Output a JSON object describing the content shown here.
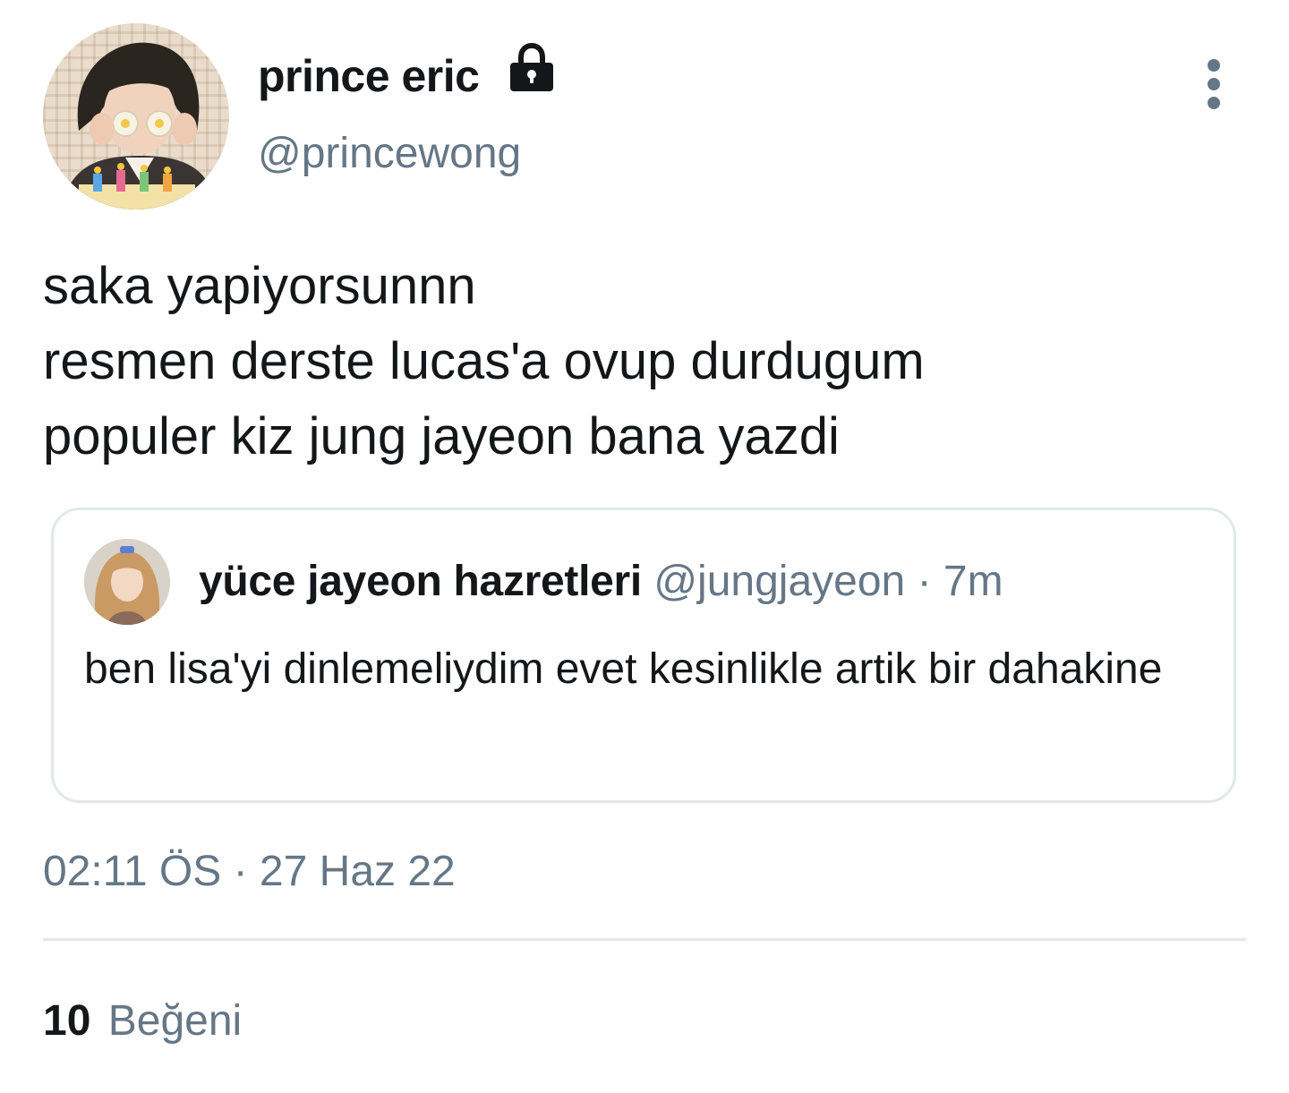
{
  "author": {
    "display_name": "prince eric",
    "handle": "@princewong",
    "protected": true,
    "lock_icon": "lock-icon",
    "avatar_icon": "user-avatar"
  },
  "tweet": {
    "lines": [
      "saka yapiyorsunnn",
      "resmen derste lucas'a ovup durdugum",
      "populer kiz jung jayeon bana yazdi"
    ]
  },
  "quoted_tweet": {
    "display_name": "yüce jayeon hazretleri",
    "handle": "@jungjayeon",
    "separator": "·",
    "time": "7m",
    "text": "ben lisa'yi dinlemeliydim evet kesinlikle artik bir dahakine"
  },
  "timestamp": {
    "time": "02:11 ÖS",
    "separator": "·",
    "date": "27 Haz 22"
  },
  "stats": {
    "likes_count": "10",
    "likes_label": "Beğeni"
  },
  "colors": {
    "text": "#14171a",
    "secondary": "#657786",
    "border": "#e1e8ed",
    "background": "#ffffff"
  }
}
